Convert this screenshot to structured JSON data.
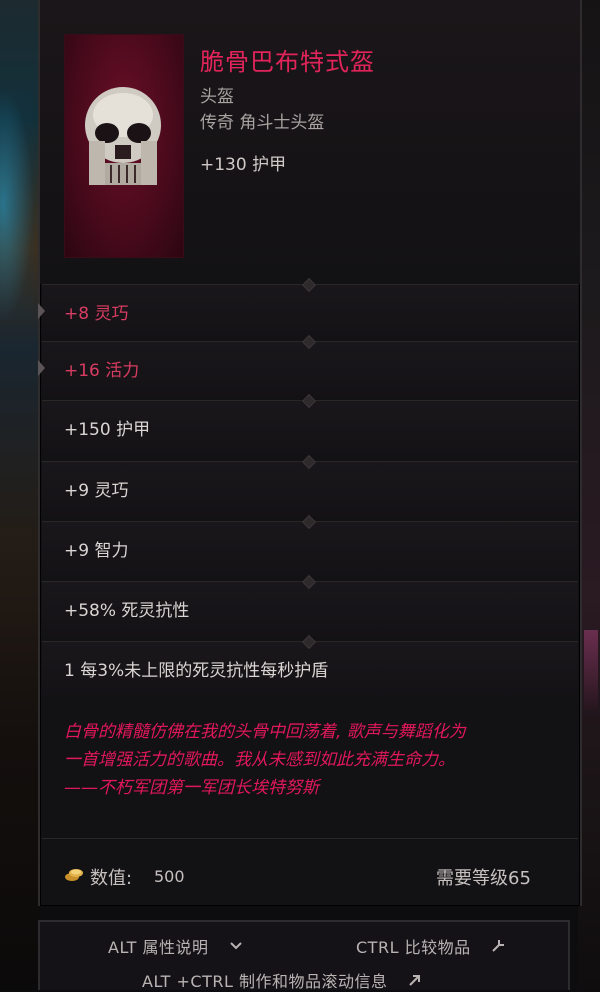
{
  "item": {
    "name": "脆骨巴布特式盔",
    "type": "头盔",
    "subtype": "传奇 角斗士头盔",
    "base_armor": "+130 护甲"
  },
  "affixes": [
    {
      "text": "+8 灵巧",
      "highlight": true
    },
    {
      "text": "+16 活力",
      "highlight": true
    },
    {
      "text": "+150 护甲",
      "highlight": false
    },
    {
      "text": "+9 灵巧",
      "highlight": false
    },
    {
      "text": "+9 智力",
      "highlight": false
    },
    {
      "text": "+58% 死灵抗性",
      "highlight": false
    },
    {
      "text": "1 每3%未上限的死灵抗性每秒护盾",
      "highlight": false
    }
  ],
  "lore": [
    "白骨的精髓仿佛在我的头骨中回荡着, 歌声与舞蹈化为",
    "一首增强活力的歌曲。我从未感到如此充满生命力。",
    "——不朽军团第一军团长埃特努斯"
  ],
  "footer": {
    "value_label": "数值:",
    "value": "500",
    "level_req": "需要等级65"
  },
  "hints": {
    "alt": "ALT 属性说明",
    "ctrl": "CTRL 比较物品",
    "altctrl": "ALT +CTRL 制作和物品滚动信息"
  },
  "icons": [
    "skull-helmet-icon",
    "gold-coins-icon",
    "chevron-down-icon",
    "compare-arrows-icon",
    "expand-arrow-icon"
  ],
  "colors": {
    "legendary_name": "#e2245a",
    "highlight_affix": "#d93c62",
    "lore_text": "#e0185a",
    "portrait_bg": "#6b0f27"
  }
}
